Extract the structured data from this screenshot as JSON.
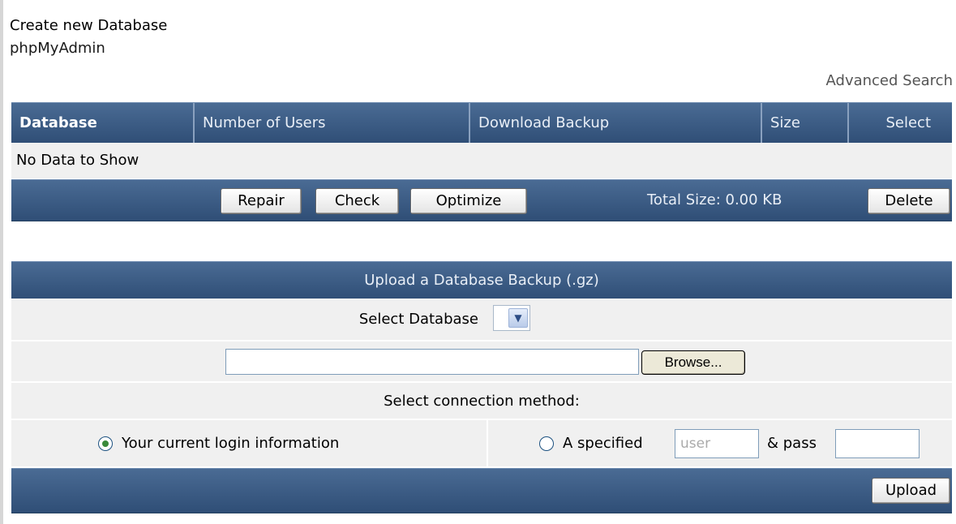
{
  "links": {
    "create_db": "Create new Database",
    "phpmyadmin": "phpMyAdmin",
    "advanced_search": "Advanced Search"
  },
  "table": {
    "columns": [
      "Database",
      "Number of Users",
      "Download Backup",
      "Size",
      "Select"
    ],
    "empty_message": "No Data to Show"
  },
  "actions": {
    "repair": "Repair",
    "check": "Check",
    "optimize": "Optimize",
    "total_size": "Total Size: 0.00 KB",
    "delete": "Delete"
  },
  "upload": {
    "title": "Upload a Database Backup (.gz)",
    "select_db_label": "Select Database",
    "select_db_value": "",
    "browse_label": "Browse...",
    "file_value": "",
    "connection_label": "Select connection method:",
    "option_current": "Your current login information",
    "option_current_selected": true,
    "option_specified": "A specified",
    "user_placeholder": "user",
    "pass_label": "& pass",
    "pass_value": "",
    "upload_button": "Upload"
  },
  "colors": {
    "header_bar": "#3a5a82",
    "row_bg": "#f0f0f0",
    "header_text": "#e8eef6"
  }
}
